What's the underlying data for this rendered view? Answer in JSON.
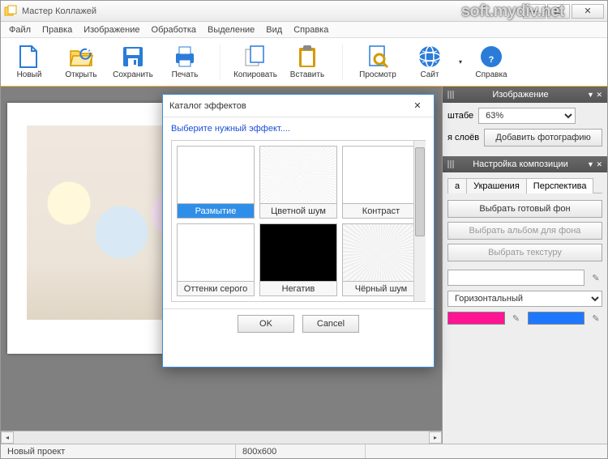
{
  "window": {
    "title": "Мастер Коллажей",
    "watermark": "soft.mydiv.net"
  },
  "menus": [
    "Файл",
    "Правка",
    "Изображение",
    "Обработка",
    "Выделение",
    "Вид",
    "Справка"
  ],
  "toolbar": {
    "new": "Новый",
    "open": "Открыть",
    "save": "Сохранить",
    "print": "Печать",
    "copy": "Копировать",
    "paste": "Вставить",
    "preview": "Просмотр",
    "site": "Сайт",
    "help": "Справка"
  },
  "panel_image": {
    "title": "Изображение",
    "scale_label": "штабе",
    "scale_value": "63%",
    "layers_label": "я слоёв",
    "add_photo": "Добавить фотографию"
  },
  "panel_comp": {
    "title": "Настройка композиции",
    "tabs": {
      "t1": "а",
      "t2": "Украшения",
      "t3": "Перспектива"
    },
    "btn_bg": "Выбрать готовый фон",
    "btn_album": "Выбрать альбом для фона",
    "btn_texture": "Выбрать текстуру",
    "orient": "Горизонтальный",
    "color1": "#ff1493",
    "color2": "#1e78ff"
  },
  "dialog": {
    "title": "Каталог эффектов",
    "hint": "Выберите нужный эффект....",
    "effects": {
      "blur": "Размытие",
      "cnoise": "Цветной шум",
      "contrast": "Контраст",
      "gray": "Оттенки серого",
      "neg": "Негатив",
      "bnoise": "Чёрный шум"
    },
    "ok": "OK",
    "cancel": "Cancel"
  },
  "status": {
    "project": "Новый проект",
    "dims": "800x600"
  }
}
